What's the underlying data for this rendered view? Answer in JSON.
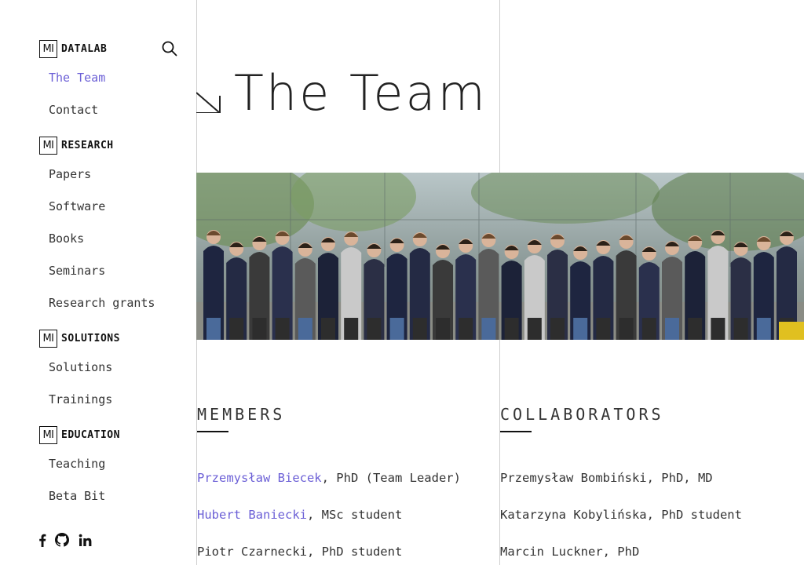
{
  "sidebar": {
    "sections": [
      {
        "badge": "MI",
        "label": "DATALAB"
      },
      {
        "badge": "MI",
        "label": "RESEARCH"
      },
      {
        "badge": "MI",
        "label": "SOLUTIONS"
      },
      {
        "badge": "MI",
        "label": "EDUCATION"
      }
    ],
    "links": {
      "team": "The Team",
      "contact": "Contact",
      "papers": "Papers",
      "software": "Software",
      "books": "Books",
      "seminars": "Seminars",
      "grants": "Research grants",
      "solutions": "Solutions",
      "trainings": "Trainings",
      "teaching": "Teaching",
      "betabit": "Beta Bit"
    },
    "social": [
      "facebook-icon",
      "github-icon",
      "linkedin-icon"
    ]
  },
  "main": {
    "title": "The Team",
    "members": {
      "heading": "MEMBERS",
      "people": [
        {
          "name": "Przemysław Biecek",
          "role": ", PhD (Team Leader)"
        },
        {
          "name": "Hubert Baniecki",
          "role": ", MSc student"
        },
        {
          "name": "",
          "role": "Piotr Czarnecki, PhD student"
        }
      ]
    },
    "collaborators": {
      "heading": "COLLABORATORS",
      "people": [
        "Przemysław Bombiński, PhD, MD",
        "Katarzyna Kobylińska, PhD student",
        "Marcin Luckner, PhD"
      ]
    }
  },
  "colors": {
    "accent": "#6b5fd6",
    "text": "#333333",
    "rule": "#cfcfcf"
  }
}
